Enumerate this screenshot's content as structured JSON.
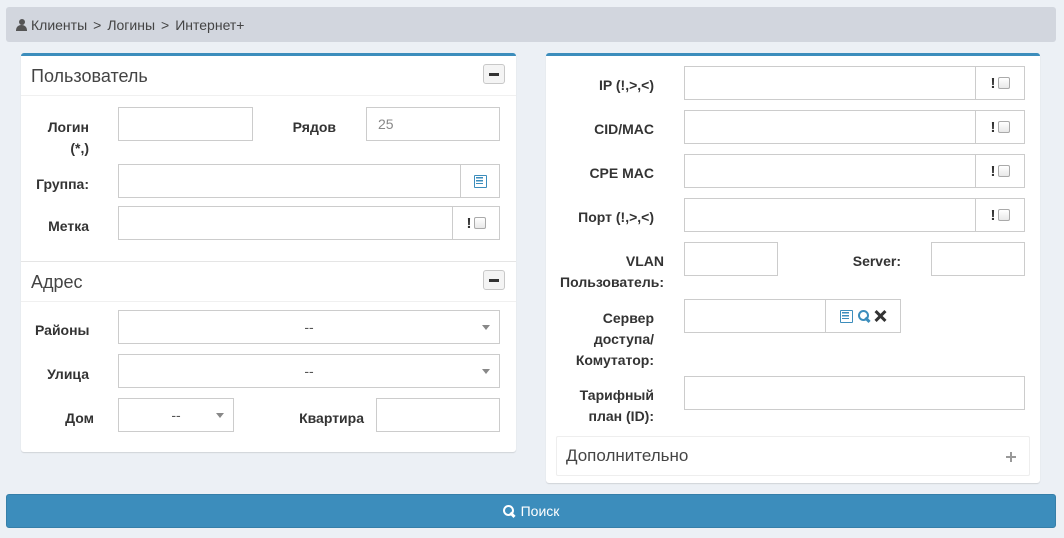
{
  "breadcrumb": {
    "items": [
      "Клиенты",
      "Логины",
      "Интернет+"
    ],
    "separator": ">"
  },
  "user_section": {
    "title": "Пользователь",
    "login_label_1": "Логин",
    "login_label_2": "(*,)",
    "login_value": "",
    "rows_label": "Рядов",
    "rows_value": "25",
    "group_label": "Группа:",
    "group_value": "",
    "tag_label": "Метка",
    "tag_value": "",
    "tag_flag": "!"
  },
  "address_section": {
    "title": "Адрес",
    "districts_label": "Районы",
    "districts_value": "--",
    "street_label": "Улица",
    "street_value": "--",
    "house_label": "Дом",
    "house_value": "--",
    "apartment_label": "Квартира",
    "apartment_value": ""
  },
  "network_section": {
    "ip_label": "IP (!,>,<)",
    "ip_flag": "!",
    "cid_label": "CID/MAC",
    "cid_flag": "!",
    "cpe_label": "CPE MAC",
    "cpe_flag": "!",
    "port_label": "Порт (!,>,<)",
    "port_flag": "!",
    "vlan_label_1": "VLAN",
    "vlan_label_2": "Пользователь:",
    "server_label": "Server:",
    "nas_label_1": "Сервер",
    "nas_label_2": "доступа/",
    "nas_label_3": "Комутатор:",
    "tariff_label_1": "Тарифный",
    "tariff_label_2": "план (ID):",
    "extra_title": "Дополнительно"
  },
  "search_button": {
    "label": "Поиск"
  },
  "colors": {
    "primary": "#3c8dbc",
    "background": "#ecf0f5",
    "breadcrumb_bg": "#d2d6de"
  }
}
